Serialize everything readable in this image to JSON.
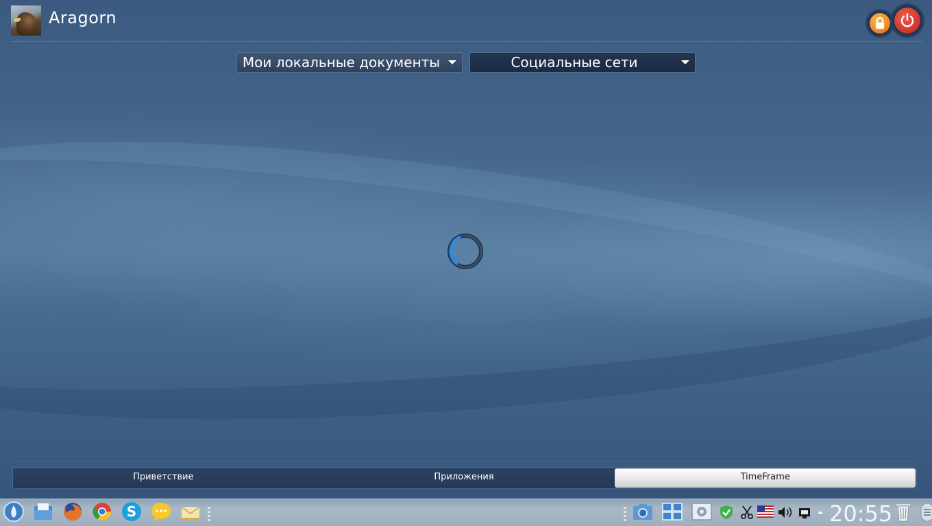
{
  "header": {
    "username": "Aragorn",
    "avatar_icon": "hawk-avatar",
    "lock_icon": "lock-icon",
    "power_icon": "power-icon"
  },
  "dropdowns": [
    {
      "label": "Мои локальные документы"
    },
    {
      "label": "Социальные сети"
    }
  ],
  "main": {
    "loading_icon": "busy-spinner"
  },
  "tabs": [
    {
      "label": "Приветствие",
      "active": false
    },
    {
      "label": "Приложения",
      "active": false
    },
    {
      "label": "TimeFrame",
      "active": true
    }
  ],
  "taskbar": {
    "launchers": [
      "app-menu-icon",
      "file-manager-icon",
      "firefox-icon",
      "chrome-icon",
      "skype-icon",
      "chat-icon",
      "mail-icon"
    ],
    "tray": [
      "screenshot-icon",
      "window-list-icon",
      "system-settings-icon",
      "update-ok-icon",
      "clipboard-scissors-icon",
      "keyboard-layout-us-flag-icon",
      "volume-icon",
      "network-icon",
      "tray-expand-arrow-icon",
      "trash-icon"
    ],
    "clock": "20:55"
  },
  "colors": {
    "accent_orange": "#f08a22",
    "power_red": "#d43a2f",
    "spinner_blue": "#2f8ae6"
  }
}
